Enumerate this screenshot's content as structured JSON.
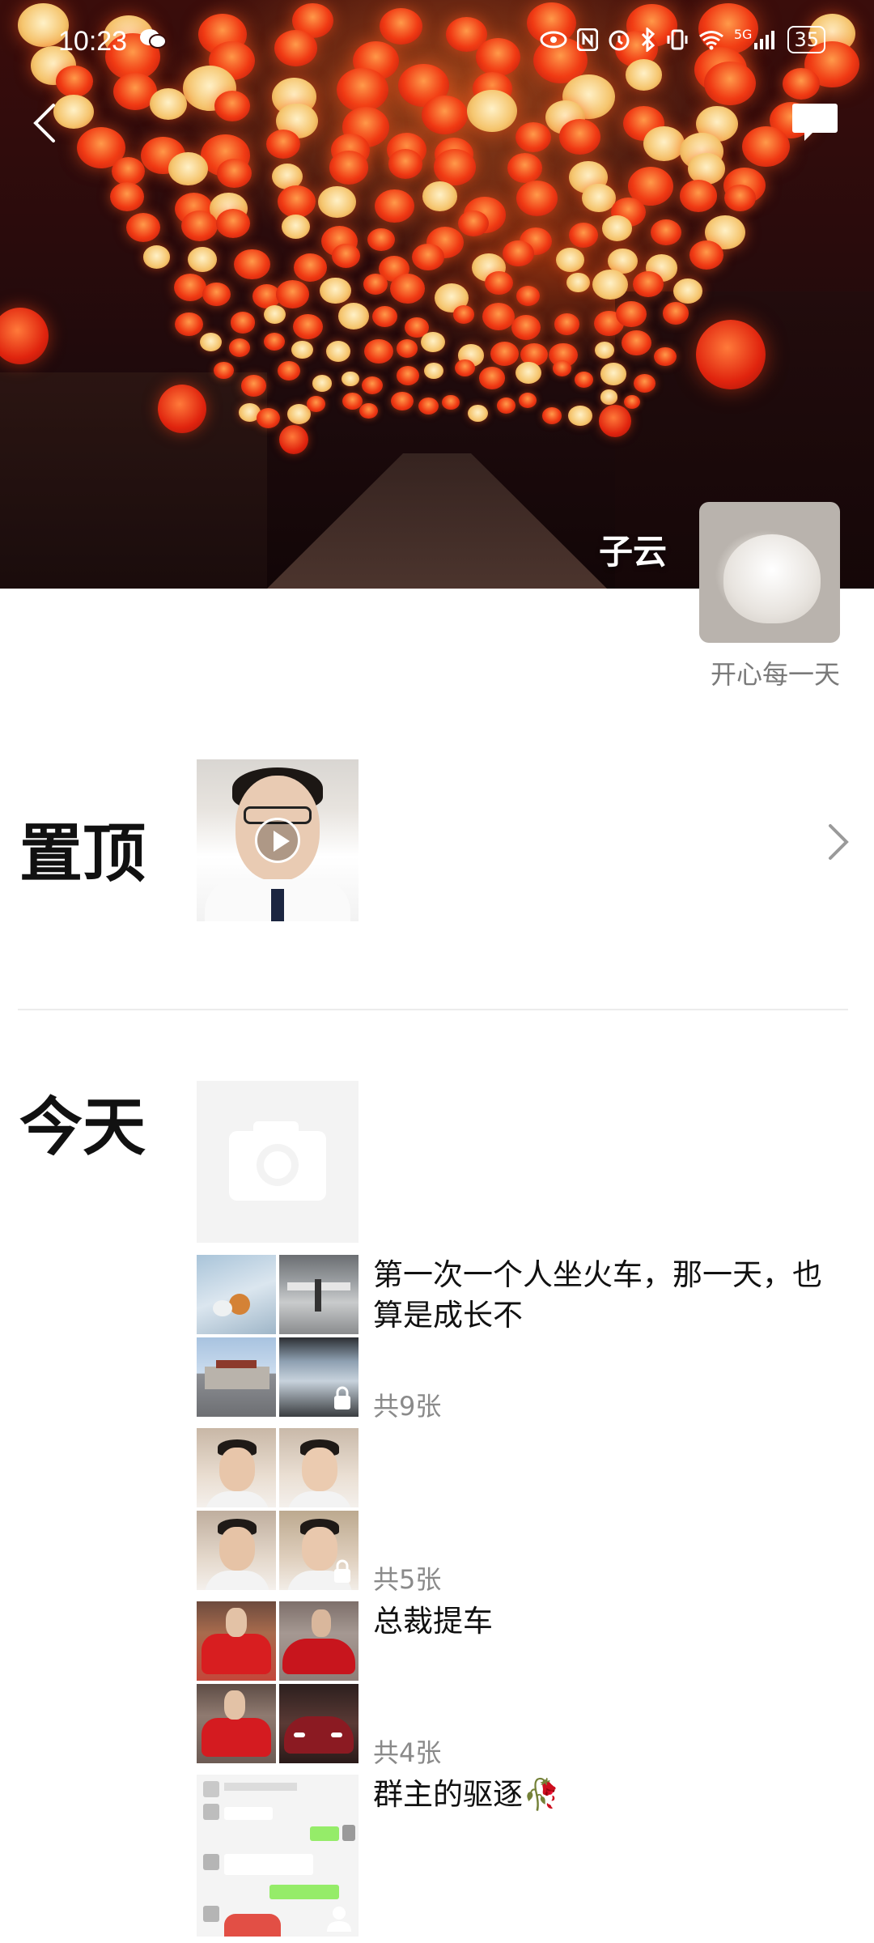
{
  "status_bar": {
    "time": "10:23",
    "network": "5G",
    "battery": "35"
  },
  "cover": {
    "user_name": "子云",
    "signature": "开心每一天"
  },
  "sections": {
    "pinned_title": "置顶",
    "today_title": "今天"
  },
  "posts": [
    {
      "text": "第一次一个人坐火车，那一天，也算是成长不",
      "count": "共9张",
      "locked": true
    },
    {
      "text": "",
      "count": "共5张",
      "locked": true
    },
    {
      "text": "总裁提车",
      "count": "共4张",
      "locked": false
    },
    {
      "text": "群主的驱逐🥀",
      "count": "",
      "locked": false
    }
  ],
  "icons": [
    "back-icon",
    "comment-icon",
    "play-icon",
    "chevron-right-icon",
    "camera-icon",
    "lock-icon",
    "person-icon"
  ],
  "colors": {
    "background": "#ffffff",
    "text": "#111111",
    "muted": "#8a8a8a",
    "divider": "#ececec"
  }
}
